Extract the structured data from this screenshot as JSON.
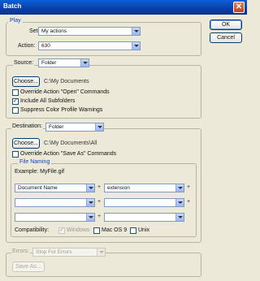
{
  "window": {
    "title": "Batch",
    "close_glyph": "✕"
  },
  "buttons": {
    "ok": "OK",
    "cancel": "Cancel"
  },
  "play": {
    "group_label": "Play",
    "set_label": "Set:",
    "set_value": "My actions",
    "action_label": "Action:",
    "action_value": "630"
  },
  "source": {
    "label": "Source:",
    "value": "Folder",
    "choose_button": "Choose...",
    "path": "C:\\My Documents",
    "options": [
      {
        "label": "Override Action \"Open\" Commands",
        "checked": false
      },
      {
        "label": "Include All Subfolders",
        "checked": true
      },
      {
        "label": "Suppress Color Profile Warnings",
        "checked": false
      }
    ]
  },
  "destination": {
    "label": "Destination:",
    "value": "Folder",
    "choose_button": "Choose...",
    "path": "C:\\My Documents\\All",
    "override_option": {
      "label": "Override Action \"Save As\" Commands",
      "checked": false
    },
    "file_naming": {
      "group_label": "File Naming",
      "example": "Example: MyFile.gif",
      "rows": [
        [
          "Document Name",
          "extension"
        ],
        [
          "",
          ""
        ],
        [
          "",
          ""
        ]
      ],
      "compatibility_label": "Compatibility:",
      "compat_options": [
        {
          "label": "Windows",
          "checked": true,
          "disabled": true
        },
        {
          "label": "Mac OS 9",
          "checked": false,
          "disabled": false
        },
        {
          "label": "Unix",
          "checked": false,
          "disabled": false
        }
      ]
    }
  },
  "errors": {
    "label": "Errors:",
    "value": "Stop For Errors",
    "save_as_button": "Save As..."
  }
}
